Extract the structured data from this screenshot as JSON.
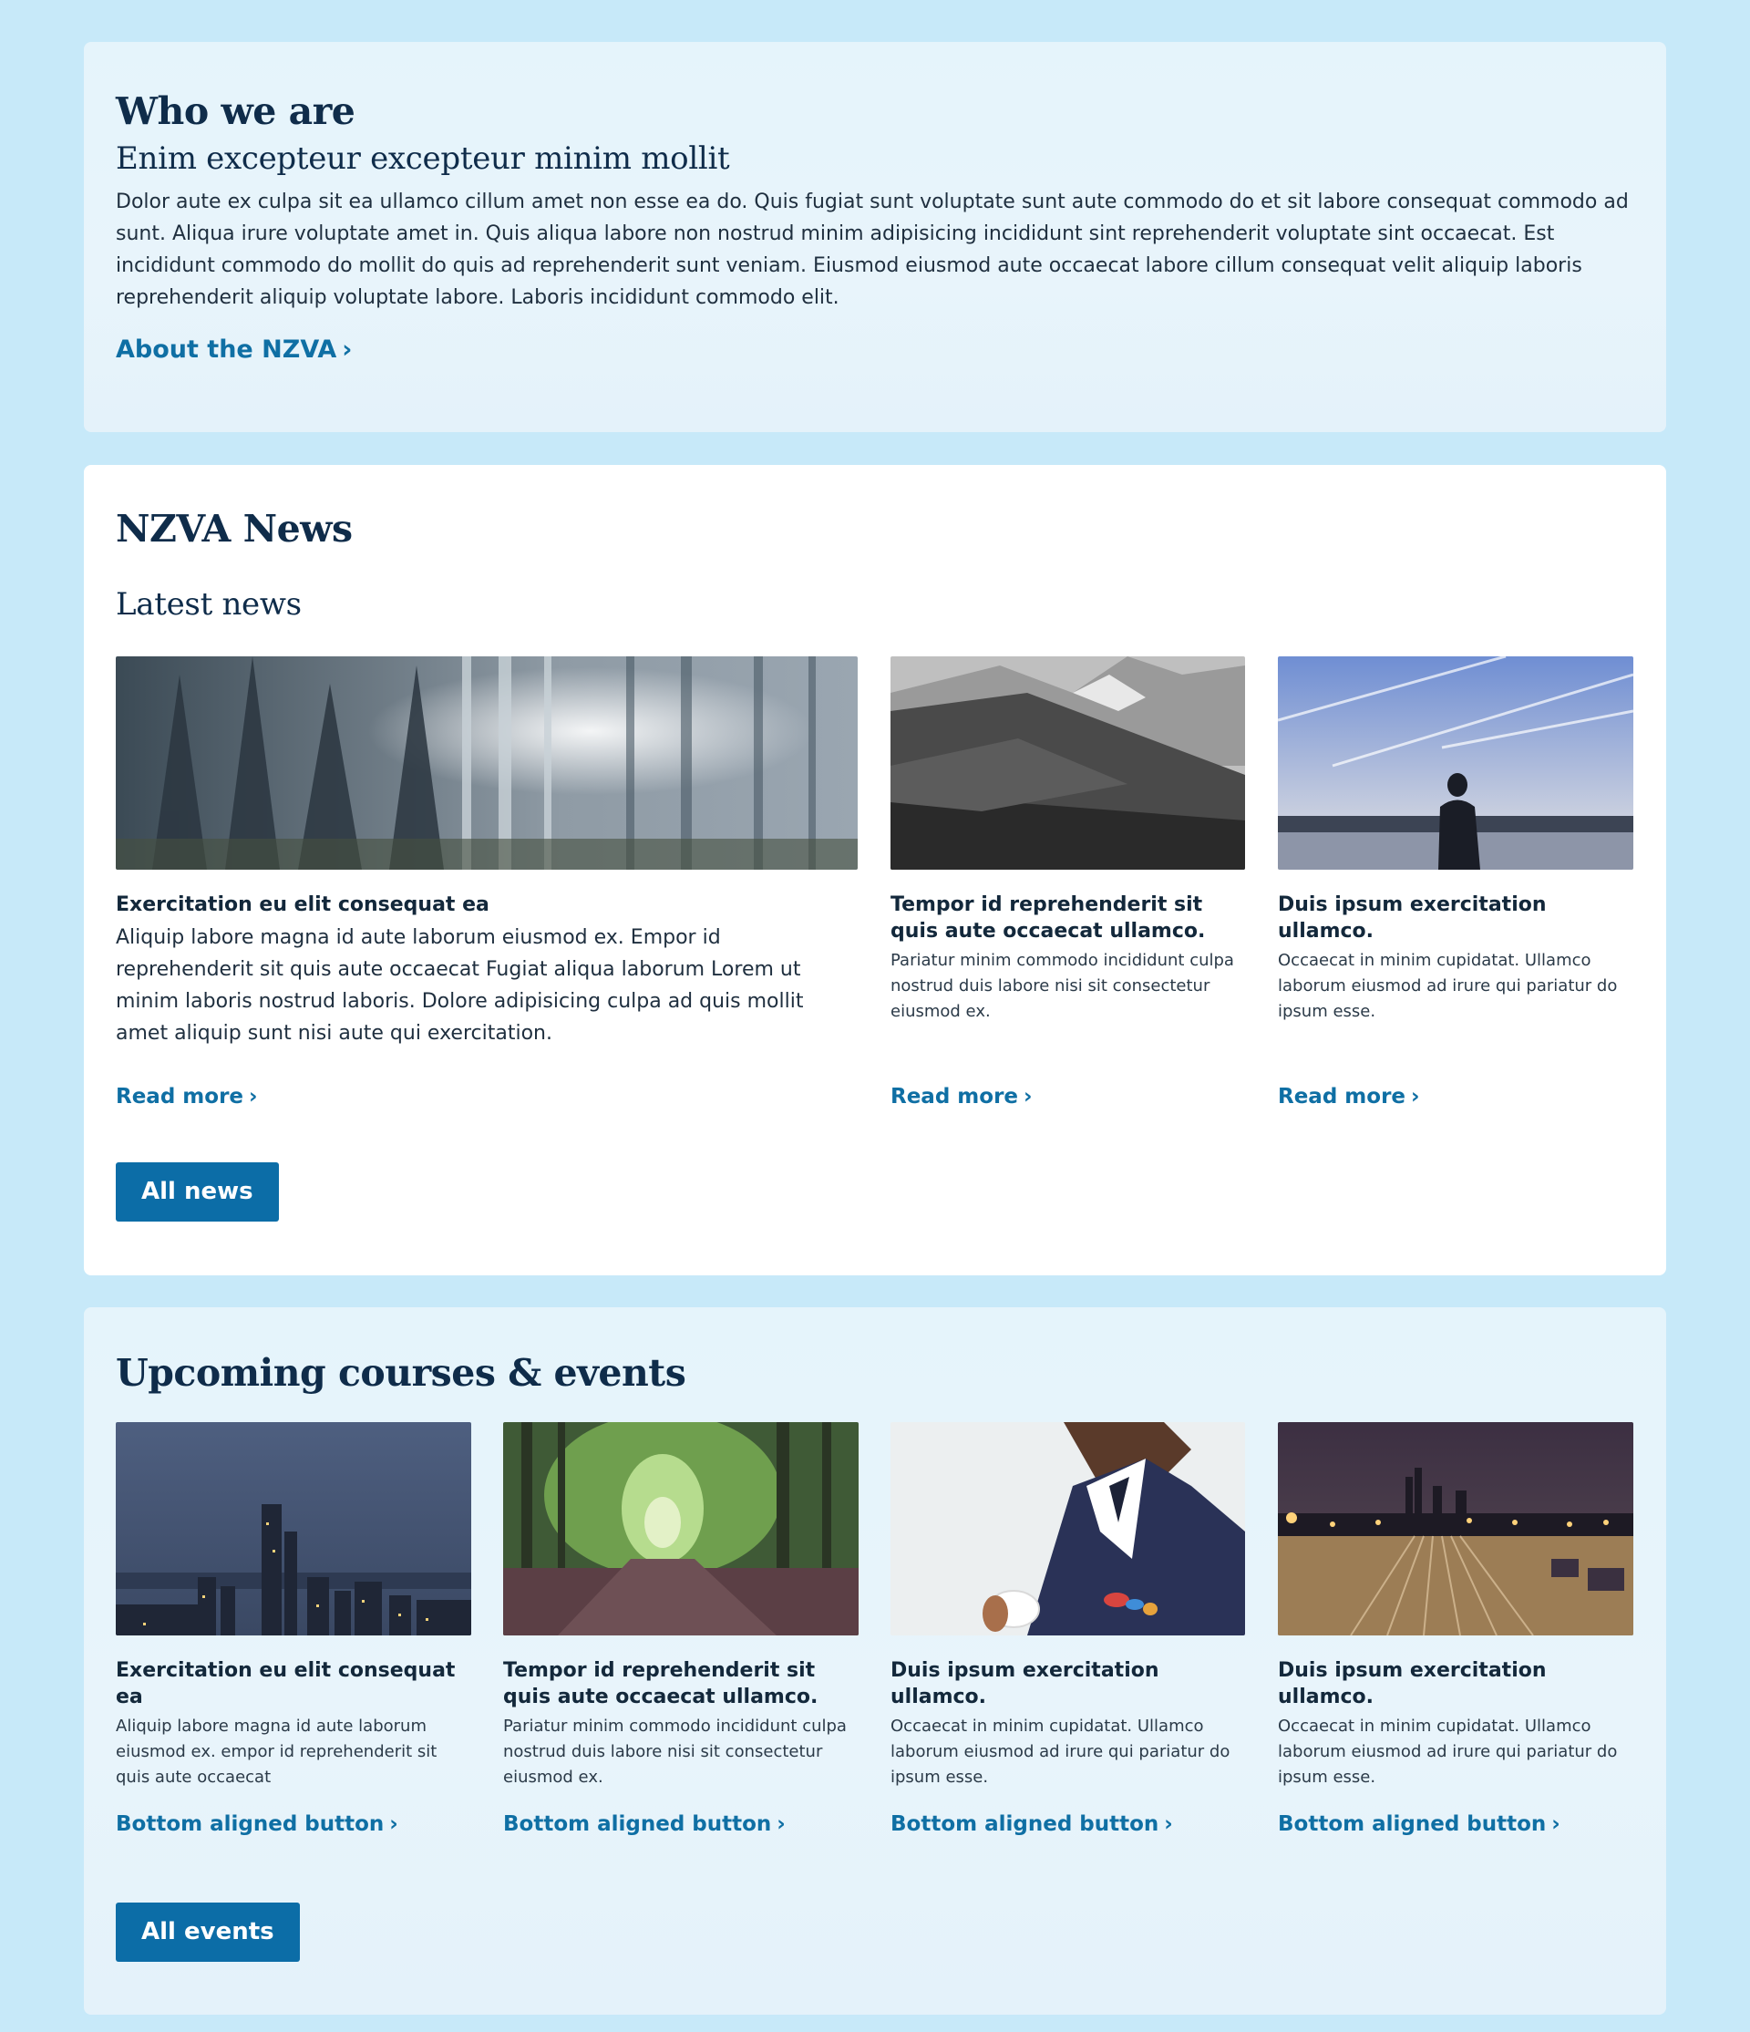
{
  "who": {
    "title": "Who we are",
    "subtitle": "Enim excepteur excepteur minim mollit",
    "body": "Dolor aute ex culpa sit ea ullamco cillum amet non esse ea do. Quis fugiat sunt voluptate sunt aute commodo do et sit labore consequat commodo ad sunt. Aliqua irure voluptate amet in. Quis aliqua labore non nostrud minim adipisicing incididunt sint reprehenderit voluptate sint occaecat. Est incididunt commodo do mollit do quis ad reprehenderit sunt veniam. Eiusmod eiusmod aute occaecat labore cillum consequat velit aliquip laboris reprehenderit aliquip voluptate labore. Laboris incididunt commodo elit.",
    "link_label": "About the NZVA",
    "chevron": "›"
  },
  "news": {
    "title": "NZVA News",
    "subtitle": "Latest news",
    "read_more": "Read more",
    "chevron": "›",
    "all_label": "All news",
    "items": [
      {
        "image": "forest-mist-photo",
        "title": "Exercitation eu elit consequat ea",
        "body": "Aliquip labore magna id aute laborum eiusmod ex. Empor id reprehenderit sit quis aute occaecat Fugiat aliqua laborum Lorem ut minim laboris nostrud laboris. Dolore adipisicing culpa ad quis mollit amet aliquip sunt nisi aute qui exercitation."
      },
      {
        "image": "mountain-bw-photo",
        "title": "Tempor id reprehenderit sit quis aute occaecat ullamco.",
        "body": "Pariatur minim commodo incididunt culpa nostrud duis labore nisi sit consectetur eiusmod ex."
      },
      {
        "image": "man-at-lake-photo",
        "title": "Duis ipsum exercitation ullamco.",
        "body": "Occaecat in minim cupidatat. Ullamco laborum eiusmod ad irure qui pariatur do ipsum esse."
      }
    ]
  },
  "events": {
    "title": "Upcoming courses & events",
    "button_label": "Bottom aligned button",
    "chevron": "›",
    "all_label": "All events",
    "items": [
      {
        "image": "city-night-photo",
        "title": "Exercitation eu elit consequat ea",
        "body": "Aliquip labore magna id aute laborum eiusmod ex. empor id reprehenderit sit quis aute occaecat"
      },
      {
        "image": "forest-path-photo",
        "title": "Tempor id reprehenderit sit quis aute occaecat ullamco.",
        "body": "Pariatur minim commodo incididunt culpa nostrud duis labore nisi sit consectetur eiusmod ex."
      },
      {
        "image": "man-suit-coffee-photo",
        "title": "Duis ipsum exercitation ullamco.",
        "body": "Occaecat in minim cupidatat. Ullamco laborum eiusmod ad irure qui pariatur do ipsum esse."
      },
      {
        "image": "railway-night-photo",
        "title": "Duis ipsum exercitation ullamco.",
        "body": "Occaecat in minim cupidatat. Ullamco laborum eiusmod ad irure qui pariatur do ipsum esse."
      }
    ]
  },
  "colors": {
    "page_background": "#c7e9f9",
    "heading": "#0f2c4a",
    "link": "#0f6fa4",
    "button": "#0c6da7"
  }
}
